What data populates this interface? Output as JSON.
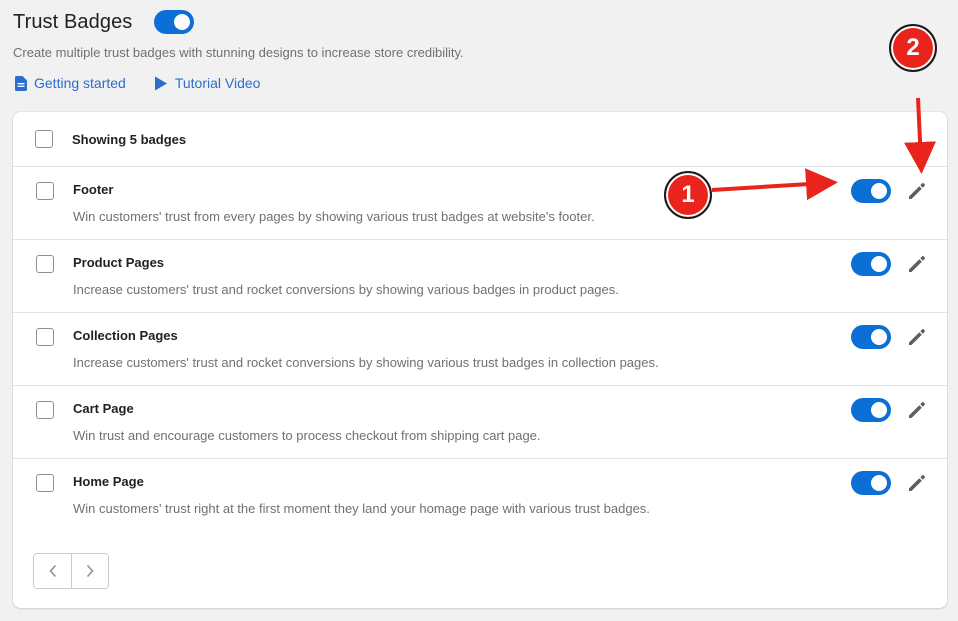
{
  "header": {
    "title": "Trust Badges",
    "enabled": true,
    "subtitle": "Create multiple trust badges with stunning designs to increase store credibility.",
    "links": [
      {
        "label": "Getting started",
        "icon": "document-icon"
      },
      {
        "label": "Tutorial Video",
        "icon": "play-icon"
      }
    ]
  },
  "list": {
    "summary": "Showing 5 badges",
    "items": [
      {
        "title": "Footer",
        "description": "Win customers' trust from every pages by showing various trust badges at website's footer.",
        "enabled": true
      },
      {
        "title": "Product Pages",
        "description": "Increase customers' trust and rocket conversions by showing various badges in product pages.",
        "enabled": true
      },
      {
        "title": "Collection Pages",
        "description": "Increase customers' trust and rocket conversions by showing various trust badges in collection pages.",
        "enabled": true
      },
      {
        "title": "Cart Page",
        "description": "Win trust and encourage customers to process checkout from shipping cart page.",
        "enabled": true
      },
      {
        "title": "Home Page",
        "description": "Win customers' trust right at the first moment they land your homage page with various trust badges.",
        "enabled": true
      }
    ]
  },
  "annotations": [
    {
      "label": "1",
      "target": "Footer toggle"
    },
    {
      "label": "2",
      "target": "Footer edit button"
    }
  ],
  "colors": {
    "accent": "#0b6fd6",
    "link": "#2c6ecb",
    "annotation": "#e8241c",
    "background": "#f1f1f1"
  }
}
